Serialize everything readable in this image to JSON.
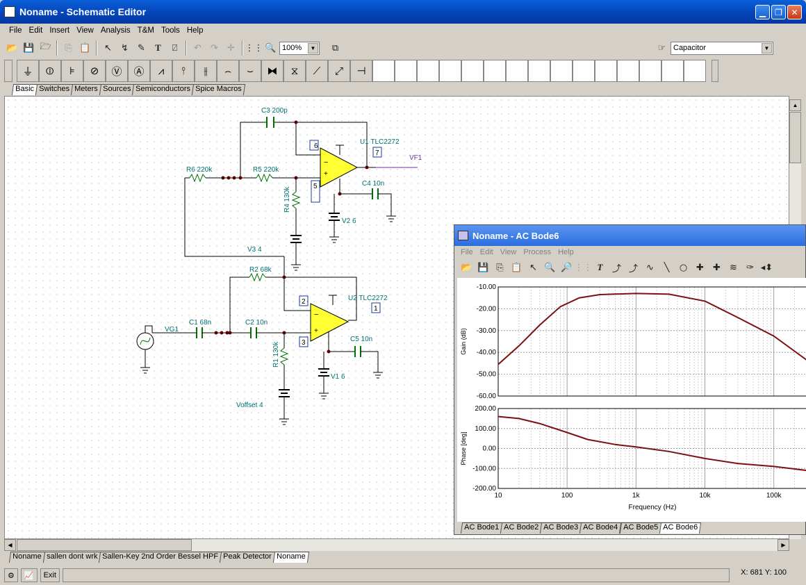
{
  "window": {
    "title": "Noname - Schematic Editor"
  },
  "menu": [
    "File",
    "Edit",
    "Insert",
    "View",
    "Analysis",
    "T&M",
    "Tools",
    "Help"
  ],
  "toolbar": {
    "zoom": "100%",
    "component": "Capacitor",
    "icons": [
      "open-icon",
      "save-icon",
      "open-folder-icon",
      "copy-icon",
      "paste-icon",
      "select-arrow-icon",
      "wire-icon",
      "pencil-icon",
      "text-icon",
      "parts-icon",
      "undo-icon",
      "redo-icon",
      "cross-icon",
      "grid-icon",
      "zoom-icon"
    ]
  },
  "palette_tabs": [
    "Basic",
    "Switches",
    "Meters",
    "Sources",
    "Semiconductors",
    "Spice Macros"
  ],
  "palette_icons": [
    "ground-icon",
    "voltage-source-icon",
    "battery-icon",
    "current-source-icon",
    "voltmeter-icon",
    "ammeter-icon",
    "resistor-icon",
    "potentiometer-icon",
    "capacitor-icon",
    "inductor-icon",
    "variable-inductor-icon",
    "transformer-icon",
    "coupled-inductor-icon",
    "switch-icon",
    "variable-resistor-icon",
    "terminal-icon"
  ],
  "schematic": {
    "labels": [
      "C3 200p",
      "U1 TLC2272",
      "VF1",
      "R6 220k",
      "R5 220k",
      "R4 130k",
      "C4 10n",
      "V2 6",
      "V3 4",
      "R2 68k",
      "U2 TLC2272",
      "VG1",
      "C1 68n",
      "C2 10n",
      "C5 10n",
      "R1 130k",
      "V1 6",
      "Voffset 4"
    ],
    "pins": [
      "6",
      "7",
      "5",
      "2",
      "1",
      "3"
    ]
  },
  "doc_tabs": [
    "Noname",
    "sallen dont wrk",
    "Sallen-Key 2nd Order Bessel HPF",
    "Peak Detector",
    "Noname"
  ],
  "statusbar": {
    "exit": "Exit",
    "coords": "X: 681  Y: 100"
  },
  "bode": {
    "title": "Noname - AC Bode6",
    "menu": [
      "File",
      "Edit",
      "View",
      "Process",
      "Help"
    ],
    "tabs": [
      "AC Bode1",
      "AC Bode2",
      "AC Bode3",
      "AC Bode4",
      "AC Bode5",
      "AC Bode6"
    ]
  },
  "chart_data": [
    {
      "type": "line",
      "ylabel": "Gain (dB)",
      "xlabel": "",
      "xscale": "log",
      "xlim": [
        10,
        300000
      ],
      "ylim": [
        -60,
        -10
      ],
      "yticks": [
        "-10.00",
        "-20.00",
        "-30.00",
        "-40.00",
        "-50.00",
        "-60.00"
      ],
      "series": [
        {
          "x": [
            10,
            20,
            40,
            80,
            150,
            300,
            1000,
            3000,
            10000,
            30000,
            100000,
            300000
          ],
          "values": [
            -45.5,
            -37,
            -27.5,
            -19,
            -15,
            -13.5,
            -13,
            -13.3,
            -16.5,
            -24,
            -32.5,
            -43.5
          ]
        }
      ]
    },
    {
      "type": "line",
      "ylabel": "Phase [deg]",
      "xlabel": "Frequency (Hz)",
      "xscale": "log",
      "xlim": [
        10,
        300000
      ],
      "ylim": [
        -200,
        200
      ],
      "xticks": [
        "10",
        "100",
        "1k",
        "10k",
        "100k"
      ],
      "yticks": [
        "200.00",
        "100.00",
        "0.00",
        "-100.00",
        "-200.00"
      ],
      "series": [
        {
          "x": [
            10,
            20,
            40,
            100,
            200,
            500,
            1000,
            3000,
            10000,
            30000,
            100000,
            300000
          ],
          "values": [
            160,
            150,
            125,
            80,
            45,
            20,
            8,
            -15,
            -50,
            -75,
            -90,
            -110
          ]
        }
      ]
    }
  ]
}
